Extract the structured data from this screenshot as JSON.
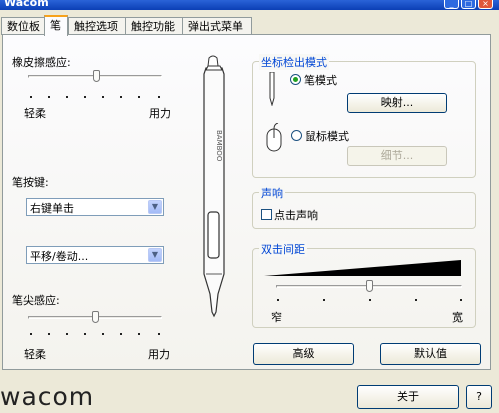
{
  "window": {
    "title": "Wacom",
    "close_glyph": "×",
    "help_glyph": "?"
  },
  "tabs": [
    "数位板",
    "笔",
    "触控选项",
    "触控功能",
    "弹出式菜单"
  ],
  "eraser_feel": {
    "label": "橡皮擦感应:",
    "soft": "轻柔",
    "firm": "用力",
    "level": 0.4
  },
  "pen_buttons": {
    "label": "笔按键:",
    "upper_value": "右键单击",
    "lower_value": "平移/卷动..."
  },
  "tip_feel": {
    "label": "笔尖感应:",
    "soft": "轻柔",
    "firm": "用力",
    "level": 0.4
  },
  "pen_image": {
    "brand": "BAMBOO"
  },
  "mode_group": {
    "title": "坐标检出模式",
    "pen_mode": "笔模式",
    "mapping_button": "映射...",
    "mouse_mode": "鼠标模式",
    "details_button": "细节..."
  },
  "sound_group": {
    "title": "声响",
    "click_sound": "点击声响"
  },
  "double_click_group": {
    "title": "双击间距",
    "narrow": "窄",
    "wide": "宽",
    "level": 0.5
  },
  "advanced_button": "高级",
  "default_button": "默认值",
  "about_button": "关于",
  "help_button": "?",
  "logo": "wacom",
  "colors": {
    "accent": "#f7a21b",
    "group_title": "#0046d5",
    "radio_dot": "#21a121"
  }
}
